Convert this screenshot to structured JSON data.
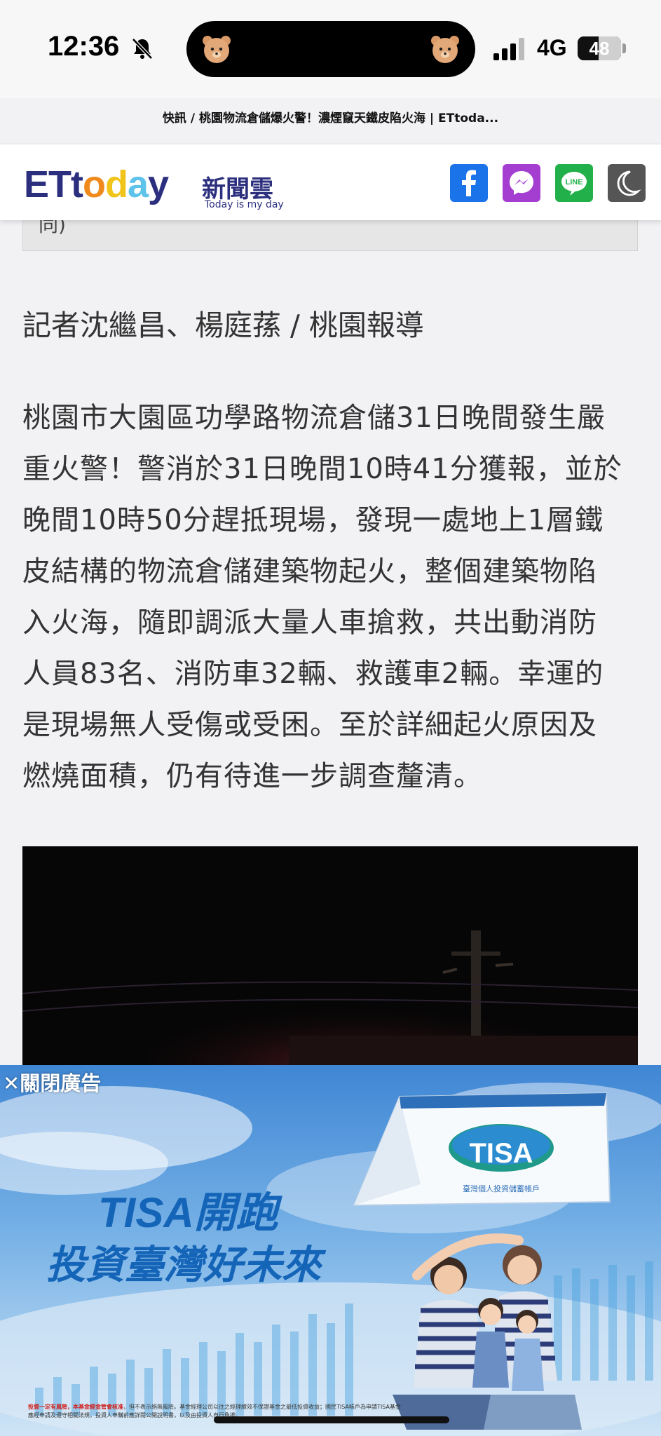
{
  "status_bar": {
    "time": "12:36",
    "network": "4G",
    "battery": "48",
    "battery_level_percent": 48
  },
  "browser": {
    "page_title": "快訊 / 桃園物流倉儲爆火警！濃煙竄天鐵皮陷火海 | ETtoda..."
  },
  "site": {
    "logo_text": "ETtoday",
    "logo_chinese": "新聞雲",
    "tagline": "Today is my day",
    "share_buttons": [
      "facebook-icon",
      "messenger-icon",
      "line-icon",
      "dark-mode-icon"
    ],
    "line_label": "LINE"
  },
  "article": {
    "prev_box_text": "同)",
    "byline": "記者沈繼昌、楊庭蓀 / 桃園報導",
    "lines": [
      "桃園市大園區功學路物流倉儲31日晚間發生嚴",
      "重火警！警消於31日晚間10時41分獲報，並於",
      "晚間10時50分趕抵現場，發現一處地上1層鐵",
      "皮結構的物流倉儲建築物起火，整個建築物陷",
      "入火海，隨即調派大量人車搶救，共出動消防",
      "人員83名、消防車32輛、救護車2輛。幸運的",
      "是現場無人受傷或受困。至於詳細起火原因及",
      "燃燒面積，仍有待進一步調查釐清。"
    ]
  },
  "ad": {
    "close_label": "✕關閉廣告",
    "headline_1": "TISA開跑",
    "headline_2": "投資臺灣好未來",
    "logo_text": "TISA",
    "logo_sub": "臺灣個人投資儲蓄帳戶",
    "fine_print_red": "投資一定有風險，本基金經金管會核准",
    "fine_print_1": "，但不表示絕無風險。基金經理公司以往之經理績效不保證基金之最低投資收益；國民TISA帳戶為申請TISA基金",
    "fine_print_2": "應經申請及遵守相關法規，投資人申購前應詳閱公開說明書，以及由投資人自行負擔。"
  },
  "colors": {
    "facebook": "#1a73e8",
    "messenger": "#a33ed1",
    "line": "#22b04a",
    "dark_mode": "#555555",
    "logo_navy": "#2b2f7e",
    "ad_blue": "#1464b8"
  }
}
